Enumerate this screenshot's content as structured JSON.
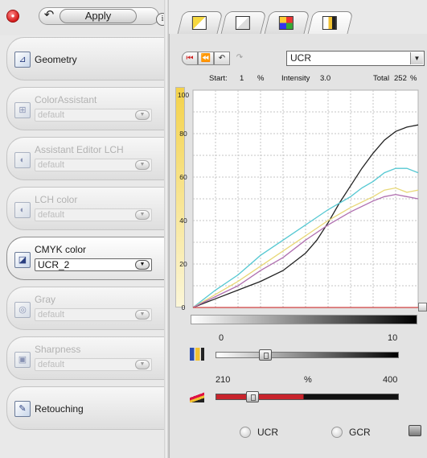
{
  "toolbar": {
    "apply_label": "Apply",
    "info_label": "i",
    "close_glyph": "●",
    "undo_glyph": "↶"
  },
  "sidebar": {
    "modules": [
      {
        "title": "Geometry",
        "icon": "geometry-icon",
        "active": false,
        "enabled": true,
        "select": null
      },
      {
        "title": "ColorAssistant",
        "icon": "color-assistant-icon",
        "active": false,
        "enabled": false,
        "select": "default"
      },
      {
        "title": "Assistant Editor LCH",
        "icon": "assistant-editor-icon",
        "active": false,
        "enabled": false,
        "select": "default"
      },
      {
        "title": "LCH color",
        "icon": "lch-color-icon",
        "active": false,
        "enabled": false,
        "select": "default"
      },
      {
        "title": "CMYK color",
        "icon": "cmyk-color-icon",
        "active": true,
        "enabled": true,
        "select": "UCR_2"
      },
      {
        "title": "Gray",
        "icon": "gray-icon",
        "active": false,
        "enabled": false,
        "select": "default"
      },
      {
        "title": "Sharpness",
        "icon": "sharpness-icon",
        "active": false,
        "enabled": false,
        "select": "default"
      },
      {
        "title": "Retouching",
        "icon": "retouching-brush-icon",
        "active": false,
        "enabled": true,
        "select": null
      }
    ]
  },
  "tabs": [
    "curve-tab-1",
    "curve-tab-2",
    "color-tab",
    "cmyk-tab"
  ],
  "curve_toolbar": {
    "reset_glyph": "⏮",
    "prev_glyph": "⏪",
    "undo_glyph": "↶",
    "redo_glyph": "↷",
    "mode_select": "UCR"
  },
  "stats": {
    "start_label": "Start:",
    "start_value": "1",
    "start_unit": "%",
    "intensity_label": "Intensity",
    "intensity_value": "3.0",
    "total_label": "Total",
    "total_value": "252",
    "total_unit": "%"
  },
  "chart_data": {
    "type": "line",
    "x_ticks": [
      "100",
      "80",
      "60",
      "40",
      "20",
      "0"
    ],
    "y_ticks": [
      "100",
      "80",
      "60",
      "40",
      "20",
      "0"
    ],
    "xlim": [
      100,
      0
    ],
    "ylim": [
      0,
      100
    ],
    "grid": true,
    "series": [
      {
        "color": "#222222",
        "x": [
          100,
          90,
          80,
          70,
          60,
          50,
          45,
          40,
          35,
          30,
          25,
          20,
          15,
          10,
          5,
          0
        ],
        "y": [
          0,
          4,
          8,
          12,
          17,
          25,
          31,
          39,
          48,
          56,
          64,
          71,
          77,
          81,
          83,
          84
        ]
      },
      {
        "color": "#55c8d2",
        "x": [
          100,
          90,
          80,
          70,
          60,
          50,
          40,
          30,
          25,
          20,
          15,
          10,
          5,
          0
        ],
        "y": [
          0,
          8,
          15,
          24,
          31,
          38,
          45,
          51,
          55,
          58,
          62,
          64,
          64,
          62
        ]
      },
      {
        "color": "#e8d878",
        "x": [
          100,
          90,
          80,
          70,
          60,
          50,
          40,
          30,
          20,
          15,
          10,
          5,
          0
        ],
        "y": [
          0,
          6,
          12,
          19,
          26,
          33,
          40,
          46,
          51,
          54,
          55,
          53,
          54
        ]
      },
      {
        "color": "#b070b0",
        "x": [
          100,
          90,
          80,
          70,
          60,
          50,
          40,
          30,
          20,
          15,
          10,
          5,
          0
        ],
        "y": [
          0,
          5,
          10,
          17,
          23,
          31,
          38,
          44,
          49,
          51,
          52,
          51,
          50
        ]
      },
      {
        "color": "#d04040",
        "x": [
          100,
          0
        ],
        "y": [
          0,
          0
        ]
      }
    ]
  },
  "ucr_slider": {
    "min_label": "0",
    "max_label": "10",
    "value": 0.27
  },
  "intensity_slider": {
    "min_label": "210",
    "unit_label": "%",
    "max_label": "400",
    "value": 0.2
  },
  "radios": {
    "ucr_label": "UCR",
    "gcr_label": "GCR"
  }
}
